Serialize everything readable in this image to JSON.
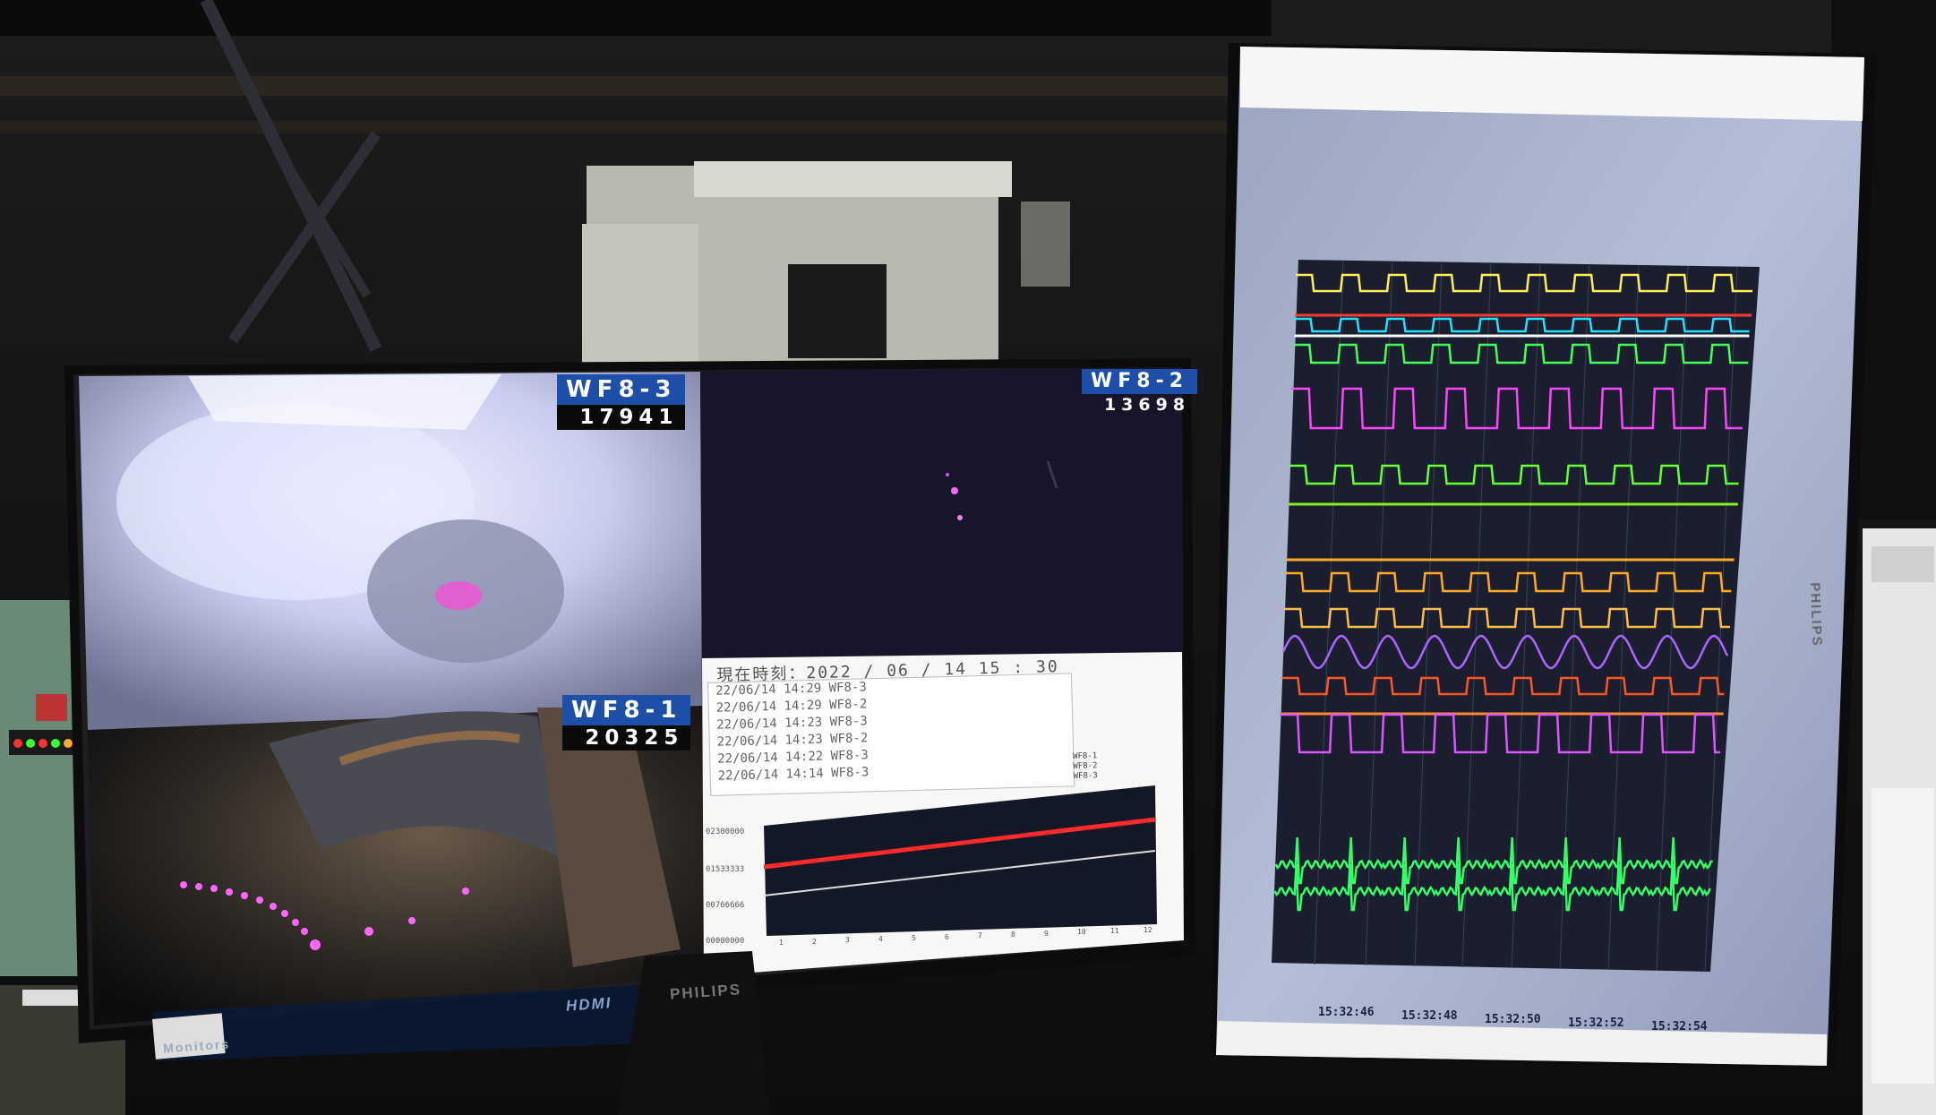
{
  "cameras": [
    {
      "name": "WF8-3",
      "count": "17941"
    },
    {
      "name": "WF8-2",
      "count": "13698"
    },
    {
      "name": "WF8-1",
      "count": "20325"
    }
  ],
  "log": {
    "header": "現在時刻：2022 / 06 / 14  15 : 30",
    "lines": [
      "22/06/14 14:29 WF8-3",
      "22/06/14 14:29 WF8-2",
      "22/06/14 14:23 WF8-3",
      "22/06/14 14:23 WF8-2",
      "22/06/14 14:22 WF8-3",
      "22/06/14 14:14 WF8-3"
    ],
    "legend": [
      "WF8-1",
      "WF8-2",
      "WF8-3"
    ]
  },
  "trend": {
    "y_ticks": [
      "02300000",
      "01533333",
      "00766666",
      "00000000"
    ],
    "x_ticks": [
      "1",
      "2",
      "3",
      "4",
      "5",
      "6",
      "7",
      "8",
      "9",
      "10",
      "11",
      "12"
    ],
    "colors": {
      "series1": "#ff2a2a",
      "series2": "#dddddd"
    }
  },
  "monitor_left": {
    "brand": "PHILIPS",
    "hdmi": "HDMI",
    "osd_title": "Monitors"
  },
  "monitor_right": {
    "brand": "PHILIPS"
  },
  "oscilloscope": {
    "time_labels": [
      "15:32:46",
      "15:32:48",
      "15:32:50",
      "15:32:52",
      "15:32:54"
    ],
    "trace_colors": [
      "#ffee55",
      "#ff3a30",
      "#22e0ff",
      "#ffffff",
      "#44ff55",
      "#ff44ff",
      "#66ff33",
      "#88ee22",
      "#ffaa22",
      "#ffbb44",
      "#aa66ff",
      "#ff5522",
      "#ff8833",
      "#dd55ff",
      "#33ff66"
    ]
  }
}
